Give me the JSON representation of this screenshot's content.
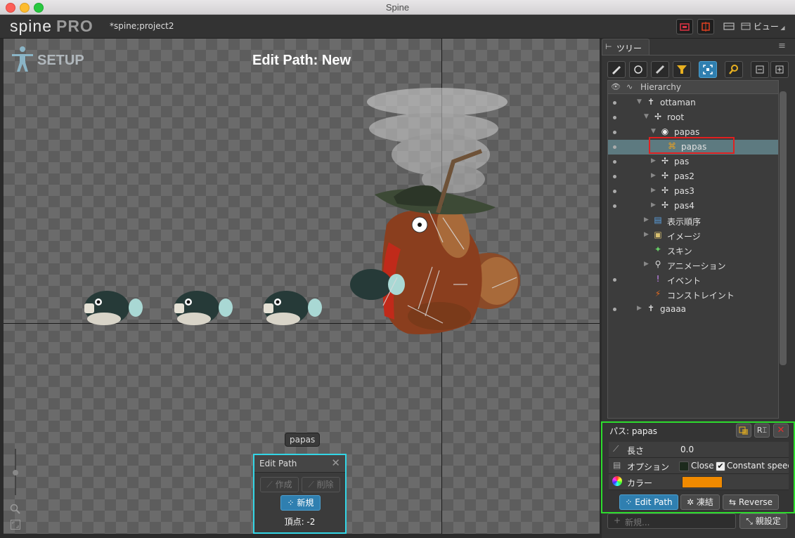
{
  "window": {
    "title": "Spine"
  },
  "app": {
    "logo": "spine",
    "edition": "PRO",
    "project": "*spine;project2",
    "view_menu": "ビュー"
  },
  "viewport": {
    "mode": "SETUP",
    "title": "Edit Path: New",
    "selected_label": "papas"
  },
  "edit_path_dialog": {
    "title": "Edit Path",
    "create_label": "作成",
    "delete_label": "削除",
    "new_label": "新規",
    "vertices_label": "頂点: -2"
  },
  "tree_panel": {
    "tab_label": "ツリー",
    "header": "Hierarchy",
    "items": [
      {
        "label": "ottaman",
        "icon": "skeleton-icon"
      },
      {
        "label": "root",
        "icon": "bone-icon"
      },
      {
        "label": "papas",
        "icon": "slot-icon"
      },
      {
        "label": "papas",
        "icon": "path-icon",
        "selected": true
      },
      {
        "label": "pas",
        "icon": "bone-icon"
      },
      {
        "label": "pas2",
        "icon": "bone-icon"
      },
      {
        "label": "pas3",
        "icon": "bone-icon"
      },
      {
        "label": "pas4",
        "icon": "bone-icon"
      },
      {
        "label": "表示順序",
        "icon": "draw-order-icon"
      },
      {
        "label": "イメージ",
        "icon": "images-folder-icon"
      },
      {
        "label": "スキン",
        "icon": "skins-icon"
      },
      {
        "label": "アニメーション",
        "icon": "animations-icon"
      },
      {
        "label": "イベント",
        "icon": "events-icon"
      },
      {
        "label": "コンストレイント",
        "icon": "constraints-icon"
      },
      {
        "label": "gaaaa",
        "icon": "skeleton-icon"
      }
    ]
  },
  "path_properties": {
    "title": "パス: papas",
    "length_label": "長さ",
    "length_value": "0.0",
    "options_label": "オプション",
    "close_label": "Close",
    "constant_speed_label": "Constant speed",
    "constant_speed_checked": true,
    "color_label": "カラー",
    "color_value": "#f08a00",
    "edit_path_button": "Edit Path",
    "freeze_button": "凍結",
    "reverse_button": "Reverse"
  },
  "bottom_bar": {
    "new_placeholder": "新規...",
    "parent_button": "親設定"
  },
  "colors": {
    "highlight_tree": "#e02020",
    "highlight_props": "#2ddc2d",
    "highlight_dialog": "#33d6e6",
    "accent_blue": "#2f7fb0"
  }
}
